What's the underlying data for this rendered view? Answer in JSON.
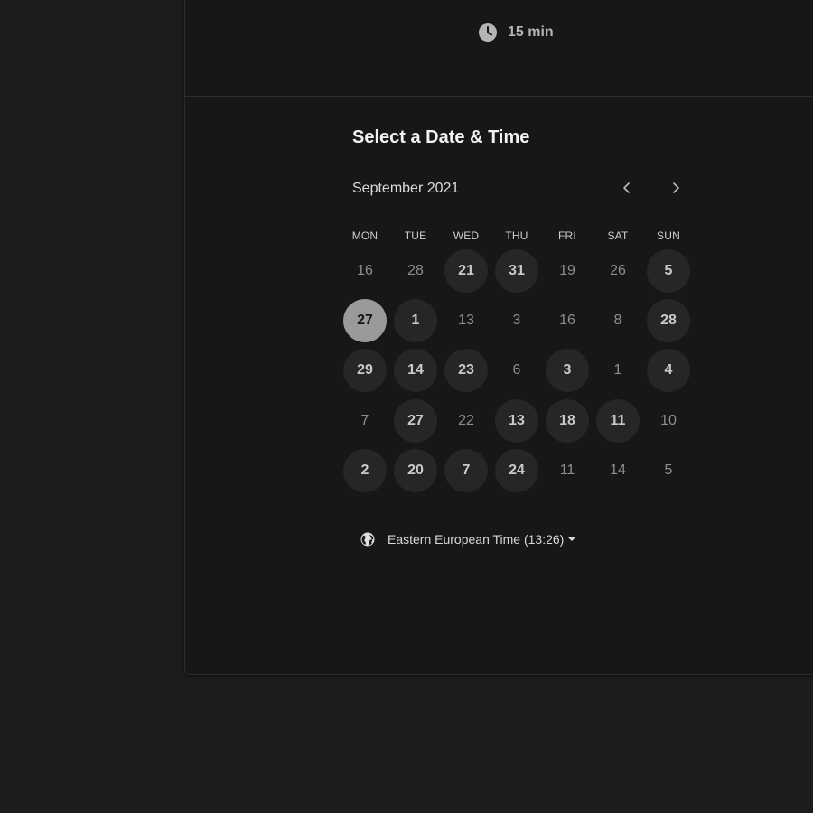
{
  "event": {
    "duration": "15 min"
  },
  "picker": {
    "title": "Select a Date & Time",
    "month": "September 2021",
    "weekdays": [
      "MON",
      "TUE",
      "WED",
      "THU",
      "FRI",
      "SAT",
      "SUN"
    ],
    "rows": [
      [
        {
          "label": "16",
          "state": "unavailable"
        },
        {
          "label": "28",
          "state": "unavailable"
        },
        {
          "label": "21",
          "state": "available"
        },
        {
          "label": "31",
          "state": "available"
        },
        {
          "label": "19",
          "state": "unavailable"
        },
        {
          "label": "26",
          "state": "unavailable"
        },
        {
          "label": "5",
          "state": "available"
        }
      ],
      [
        {
          "label": "27",
          "state": "selected"
        },
        {
          "label": "1",
          "state": "available"
        },
        {
          "label": "13",
          "state": "unavailable"
        },
        {
          "label": "3",
          "state": "unavailable"
        },
        {
          "label": "16",
          "state": "unavailable"
        },
        {
          "label": "8",
          "state": "unavailable"
        },
        {
          "label": "28",
          "state": "available"
        }
      ],
      [
        {
          "label": "29",
          "state": "available"
        },
        {
          "label": "14",
          "state": "available"
        },
        {
          "label": "23",
          "state": "available"
        },
        {
          "label": "6",
          "state": "unavailable"
        },
        {
          "label": "3",
          "state": "available"
        },
        {
          "label": "1",
          "state": "unavailable"
        },
        {
          "label": "4",
          "state": "available"
        }
      ],
      [
        {
          "label": "7",
          "state": "unavailable"
        },
        {
          "label": "27",
          "state": "available"
        },
        {
          "label": "22",
          "state": "unavailable"
        },
        {
          "label": "13",
          "state": "available"
        },
        {
          "label": "18",
          "state": "available"
        },
        {
          "label": "11",
          "state": "available"
        },
        {
          "label": "10",
          "state": "unavailable"
        }
      ],
      [
        {
          "label": "2",
          "state": "available"
        },
        {
          "label": "20",
          "state": "available"
        },
        {
          "label": "7",
          "state": "available"
        },
        {
          "label": "24",
          "state": "available"
        },
        {
          "label": "11",
          "state": "unavailable"
        },
        {
          "label": "14",
          "state": "unavailable"
        },
        {
          "label": "5",
          "state": "unavailable"
        }
      ]
    ]
  },
  "timezone": {
    "label": "Eastern European Time (13:26)"
  },
  "icons": {
    "duration": "clock-icon",
    "prev": "chevron-left-icon",
    "next": "chevron-right-icon",
    "timezone": "globe-icon",
    "dropdown": "caret-down-icon"
  },
  "colors": {
    "page_background": "#1c1c1c",
    "card_background": "#171717",
    "available_day": "#262626",
    "selected_day": "#9a9a9a"
  }
}
